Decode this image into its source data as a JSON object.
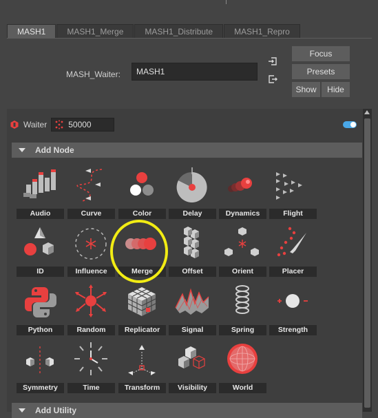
{
  "tabs": [
    {
      "label": "MASH1",
      "active": true
    },
    {
      "label": "MASH1_Merge",
      "active": false
    },
    {
      "label": "MASH1_Distribute",
      "active": false
    },
    {
      "label": "MASH1_Repro",
      "active": false
    }
  ],
  "waiter": {
    "label": "MASH_Waiter:",
    "value": "MASH1"
  },
  "buttons": {
    "focus": "Focus",
    "presets": "Presets",
    "show": "Show",
    "hide": "Hide"
  },
  "waiter_row": {
    "label": "Waiter",
    "count": "50000"
  },
  "add_node": {
    "header": "Add Node",
    "nodes": [
      {
        "label": "Audio",
        "icon": "audio-icon"
      },
      {
        "label": "Curve",
        "icon": "curve-icon"
      },
      {
        "label": "Color",
        "icon": "color-icon"
      },
      {
        "label": "Delay",
        "icon": "delay-icon"
      },
      {
        "label": "Dynamics",
        "icon": "dynamics-icon"
      },
      {
        "label": "Flight",
        "icon": "flight-icon"
      },
      {
        "label": "ID",
        "icon": "id-icon"
      },
      {
        "label": "Influence",
        "icon": "influence-icon"
      },
      {
        "label": "Merge",
        "icon": "merge-icon"
      },
      {
        "label": "Offset",
        "icon": "offset-icon"
      },
      {
        "label": "Orient",
        "icon": "orient-icon"
      },
      {
        "label": "Placer",
        "icon": "placer-icon"
      },
      {
        "label": "Python",
        "icon": "python-icon"
      },
      {
        "label": "Random",
        "icon": "random-icon"
      },
      {
        "label": "Replicator",
        "icon": "replicator-icon"
      },
      {
        "label": "Signal",
        "icon": "signal-icon"
      },
      {
        "label": "Spring",
        "icon": "spring-icon"
      },
      {
        "label": "Strength",
        "icon": "strength-icon"
      },
      {
        "label": "Symmetry",
        "icon": "symmetry-icon"
      },
      {
        "label": "Time",
        "icon": "time-icon"
      },
      {
        "label": "Transform",
        "icon": "transform-icon"
      },
      {
        "label": "Visibility",
        "icon": "visibility-icon"
      },
      {
        "label": "World",
        "icon": "world-icon"
      }
    ]
  },
  "add_utility": {
    "header": "Add Utility"
  },
  "colors": {
    "accent_red": "#e8403f",
    "toggle_blue": "#4aa8e8",
    "highlight_yellow": "#f2ec14"
  }
}
